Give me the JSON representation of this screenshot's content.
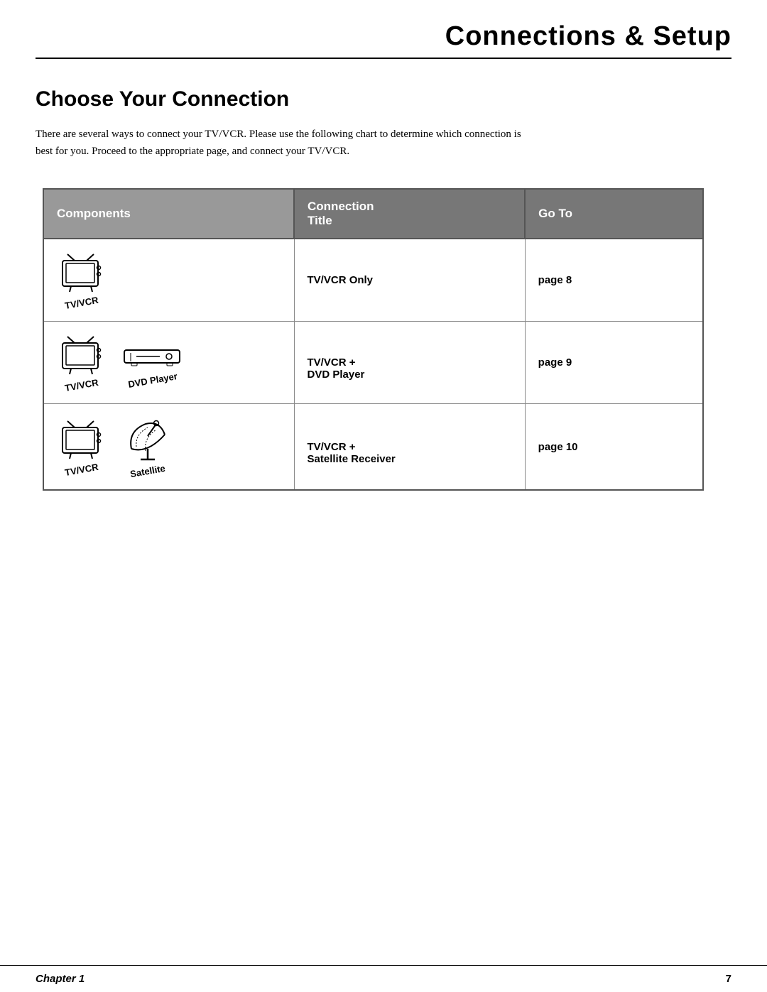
{
  "header": {
    "title": "Connections & Setup",
    "rule": true
  },
  "section": {
    "title": "Choose Your Connection",
    "intro": "There are several ways to connect your TV/VCR. Please use the following chart to determine which connection is best for you. Proceed to the appropriate page, and connect your TV/VCR."
  },
  "table": {
    "columns": [
      {
        "key": "components",
        "label": "Components"
      },
      {
        "key": "connection_title",
        "label": "Connection Title"
      },
      {
        "key": "goto",
        "label": "Go To"
      }
    ],
    "rows": [
      {
        "components": [
          "TV/VCR"
        ],
        "connection_title": "TV/VCR Only",
        "goto": "page 8"
      },
      {
        "components": [
          "TV/VCR",
          "DVD Player"
        ],
        "connection_title": "TV/VCR +\nDVD Player",
        "goto": "page 9"
      },
      {
        "components": [
          "TV/VCR",
          "Satellite"
        ],
        "connection_title": "TV/VCR +\nSatellite Receiver",
        "goto": "page 10"
      }
    ]
  },
  "footer": {
    "chapter_label": "Chapter 1",
    "page_number": "7"
  }
}
